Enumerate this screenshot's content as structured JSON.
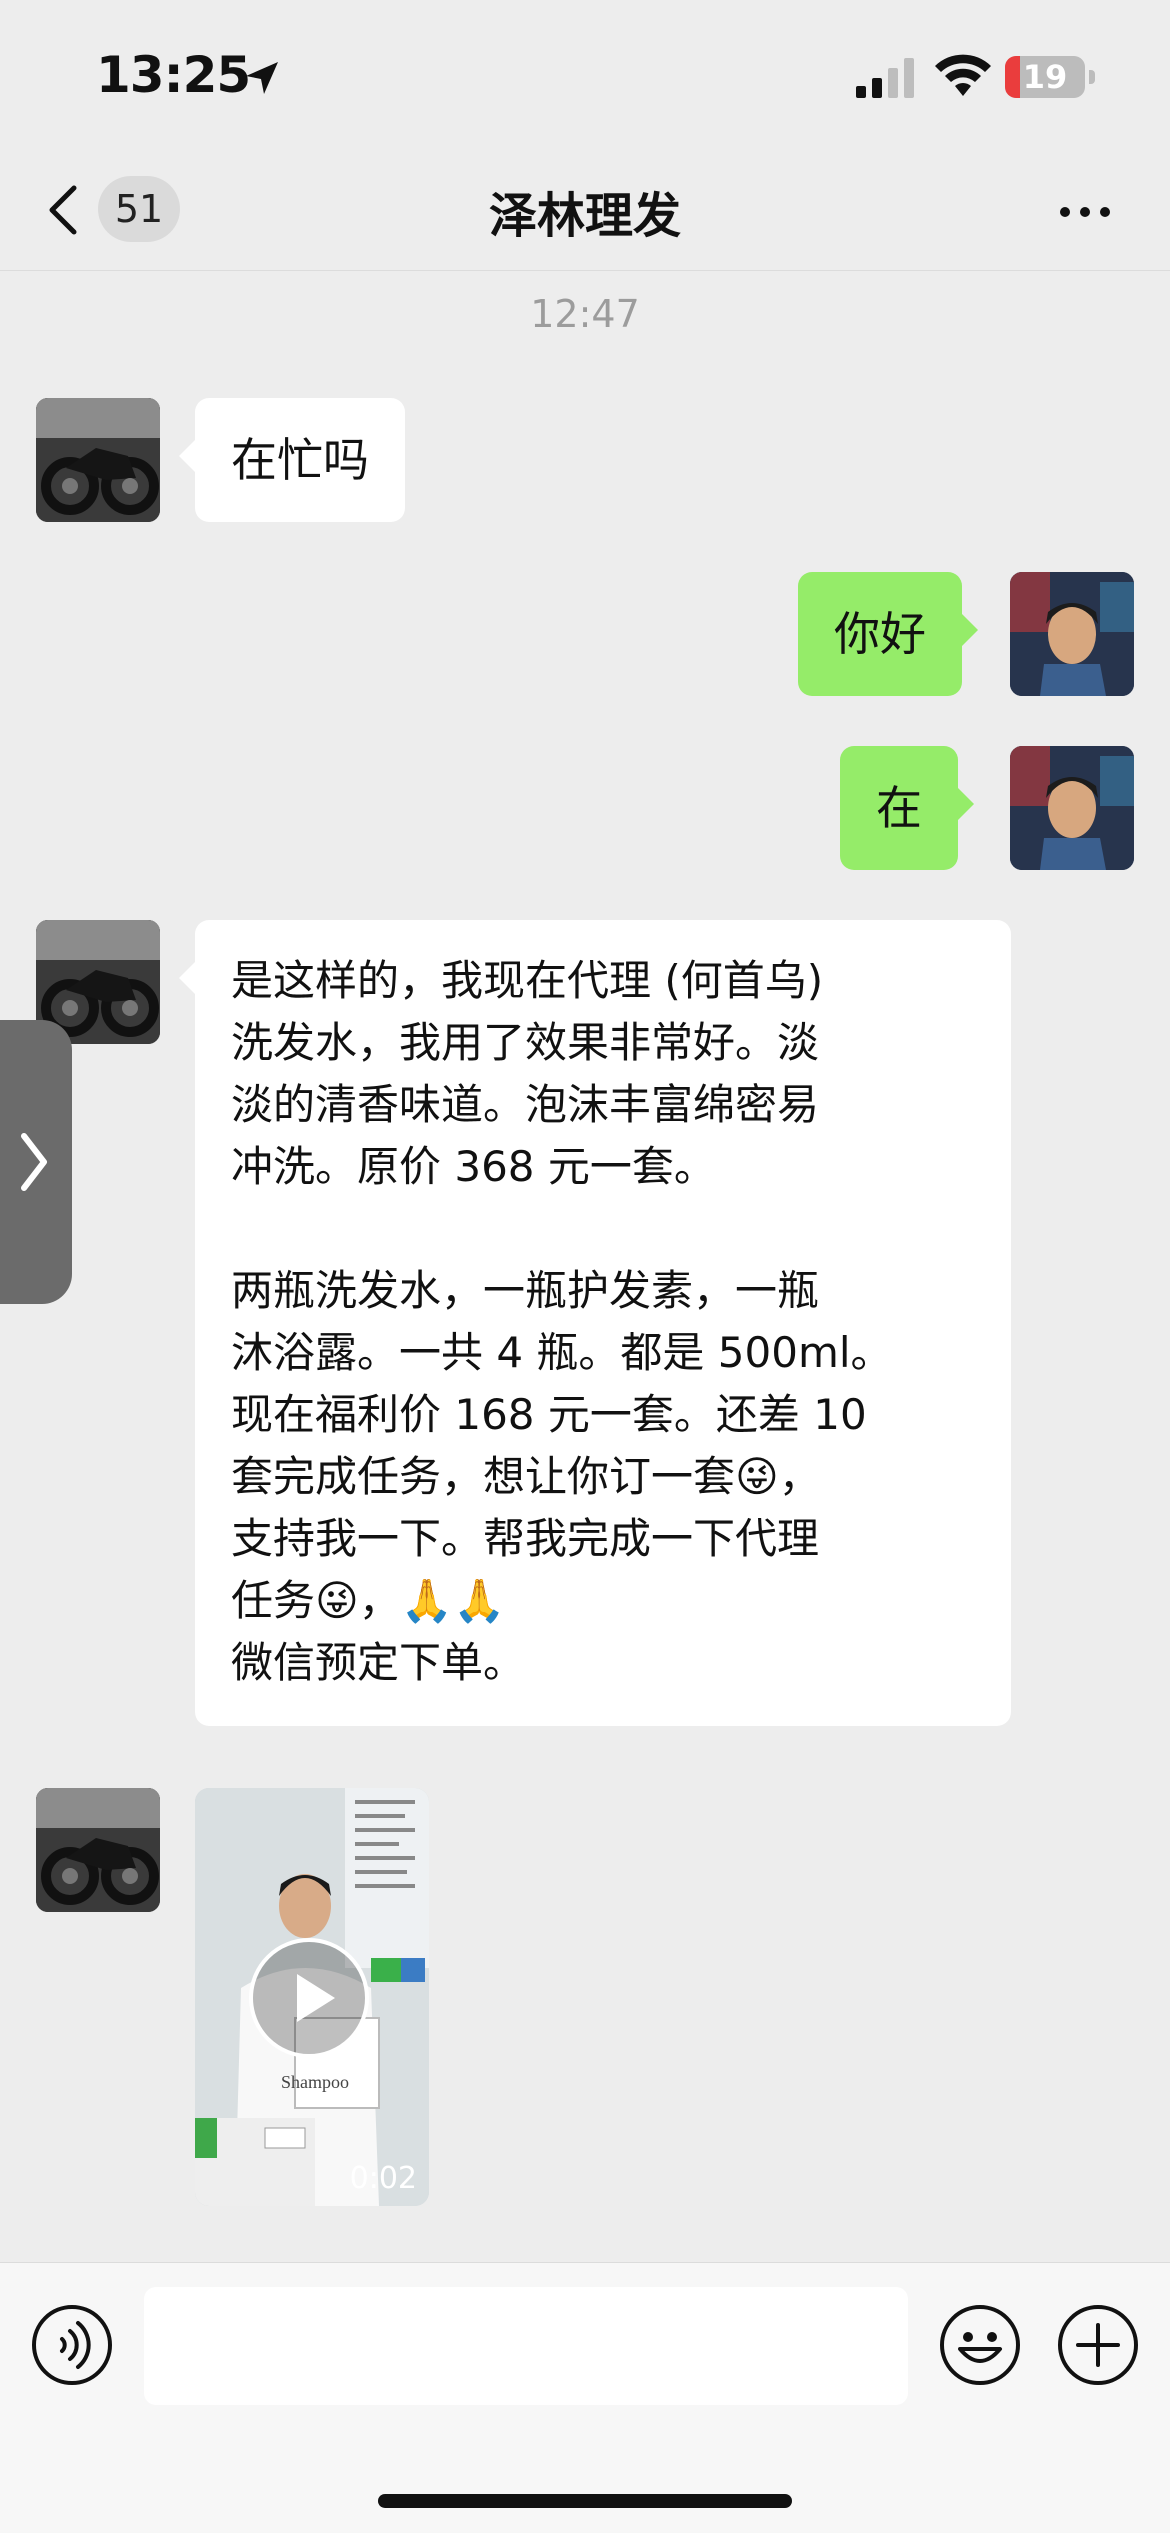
{
  "status_bar": {
    "time": "13:25",
    "battery": "19",
    "battery_level": 0.19
  },
  "nav": {
    "unread_count": "51",
    "title": "泽林理发"
  },
  "timestamp": "12:47",
  "messages": [
    {
      "side": "in",
      "text": "在忙吗"
    },
    {
      "side": "out",
      "text": "你好"
    },
    {
      "side": "out",
      "text": "在"
    },
    {
      "side": "in",
      "text": "是这样的，我现在代理 (何首乌)\n洗发水，我用了效果非常好。淡\n淡的清香味道。泡沫丰富绵密易\n冲洗。原价 368 元一套。\n\n两瓶洗发水，一瓶护发素，一瓶\n沐浴露。一共 4 瓶。都是 500ml。\n现在福利价 168 元一套。还差 10\n套完成任务，想让你订一套😜，\n支持我一下。帮我完成一下代理\n任务😜，🙏🙏\n微信预定下单。"
    }
  ],
  "video": {
    "duration": "0:02",
    "box_label": "Shampoo"
  },
  "colors": {
    "background": "#ededed",
    "bubble_out": "#95ec69",
    "bubble_in": "#ffffff",
    "battery_low": "#ea3d3d"
  },
  "icons": [
    "location-arrow-icon",
    "signal-icon",
    "wifi-icon",
    "battery-icon",
    "back-chevron-icon",
    "more-icon",
    "play-icon",
    "voice-icon",
    "emoji-icon",
    "plus-icon",
    "chevron-right-icon"
  ]
}
